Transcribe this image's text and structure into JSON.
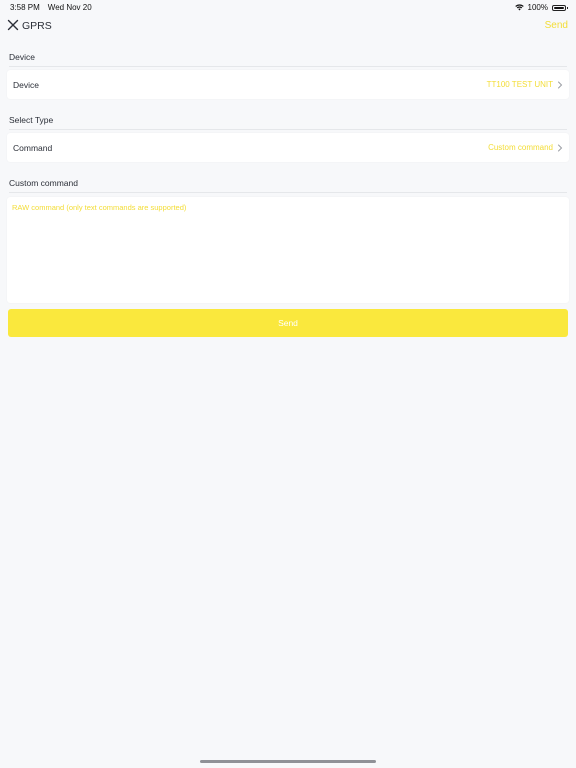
{
  "status_bar": {
    "time": "3:58 PM",
    "date": "Wed Nov 20",
    "battery_percent": "100%",
    "wifi_icon": "wifi-icon",
    "battery_icon": "battery-icon"
  },
  "nav": {
    "title": "GPRS",
    "send_label": "Send",
    "close_icon": "close-icon",
    "accent_color": "#f3dd36"
  },
  "device_section": {
    "header": "Device",
    "row_label": "Device",
    "row_value": "TT100 TEST UNIT"
  },
  "type_section": {
    "header": "Select Type",
    "row_label": "Command",
    "row_value": "Custom command"
  },
  "custom_section": {
    "header": "Custom command",
    "placeholder": "RAW command (only text commands are supported)",
    "value": ""
  },
  "send_button": {
    "label": "Send",
    "color": "#fae83d"
  }
}
